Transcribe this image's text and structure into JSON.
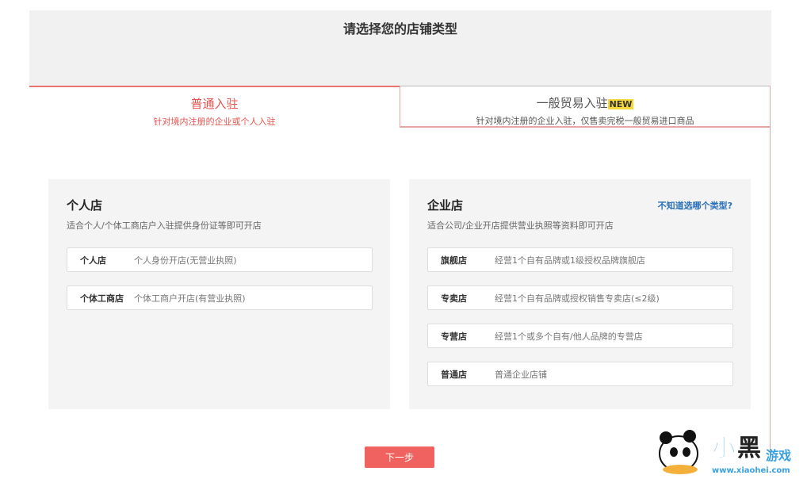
{
  "header": {
    "title": "请选择您的店铺类型"
  },
  "tabs": [
    {
      "label": "普通入驻",
      "sub": "针对境内注册的企业或个人入驻"
    },
    {
      "label": "一般贸易入驻",
      "badge": "NEW",
      "sub": "针对境内注册的企业入驻，仅售卖完税一般贸易进口商品"
    }
  ],
  "personal": {
    "title": "个人店",
    "desc": "适合个人/个体工商店户入驻提供身份证等即可开店",
    "options": [
      {
        "name": "个人店",
        "desc": "个人身份开店(无营业执照)"
      },
      {
        "name": "个体工商店",
        "desc": "个体工商户开店(有营业执照)"
      }
    ]
  },
  "enterprise": {
    "title": "企业店",
    "help": "不知道选哪个类型?",
    "desc": "适合公司/企业开店提供营业执照等资料即可开店",
    "options": [
      {
        "name": "旗舰店",
        "desc": "经营1个自有品牌或1级授权品牌旗舰店"
      },
      {
        "name": "专卖店",
        "desc": "经营1个自有品牌或授权销售专卖店(≤2级)"
      },
      {
        "name": "专营店",
        "desc": "经营1个或多个自有/他人品牌的专营店"
      },
      {
        "name": "普通店",
        "desc": "普通企业店铺"
      }
    ]
  },
  "next_label": "下一步",
  "watermark": {
    "text": "小黑游戏",
    "url": "www.xiaohei.com"
  }
}
